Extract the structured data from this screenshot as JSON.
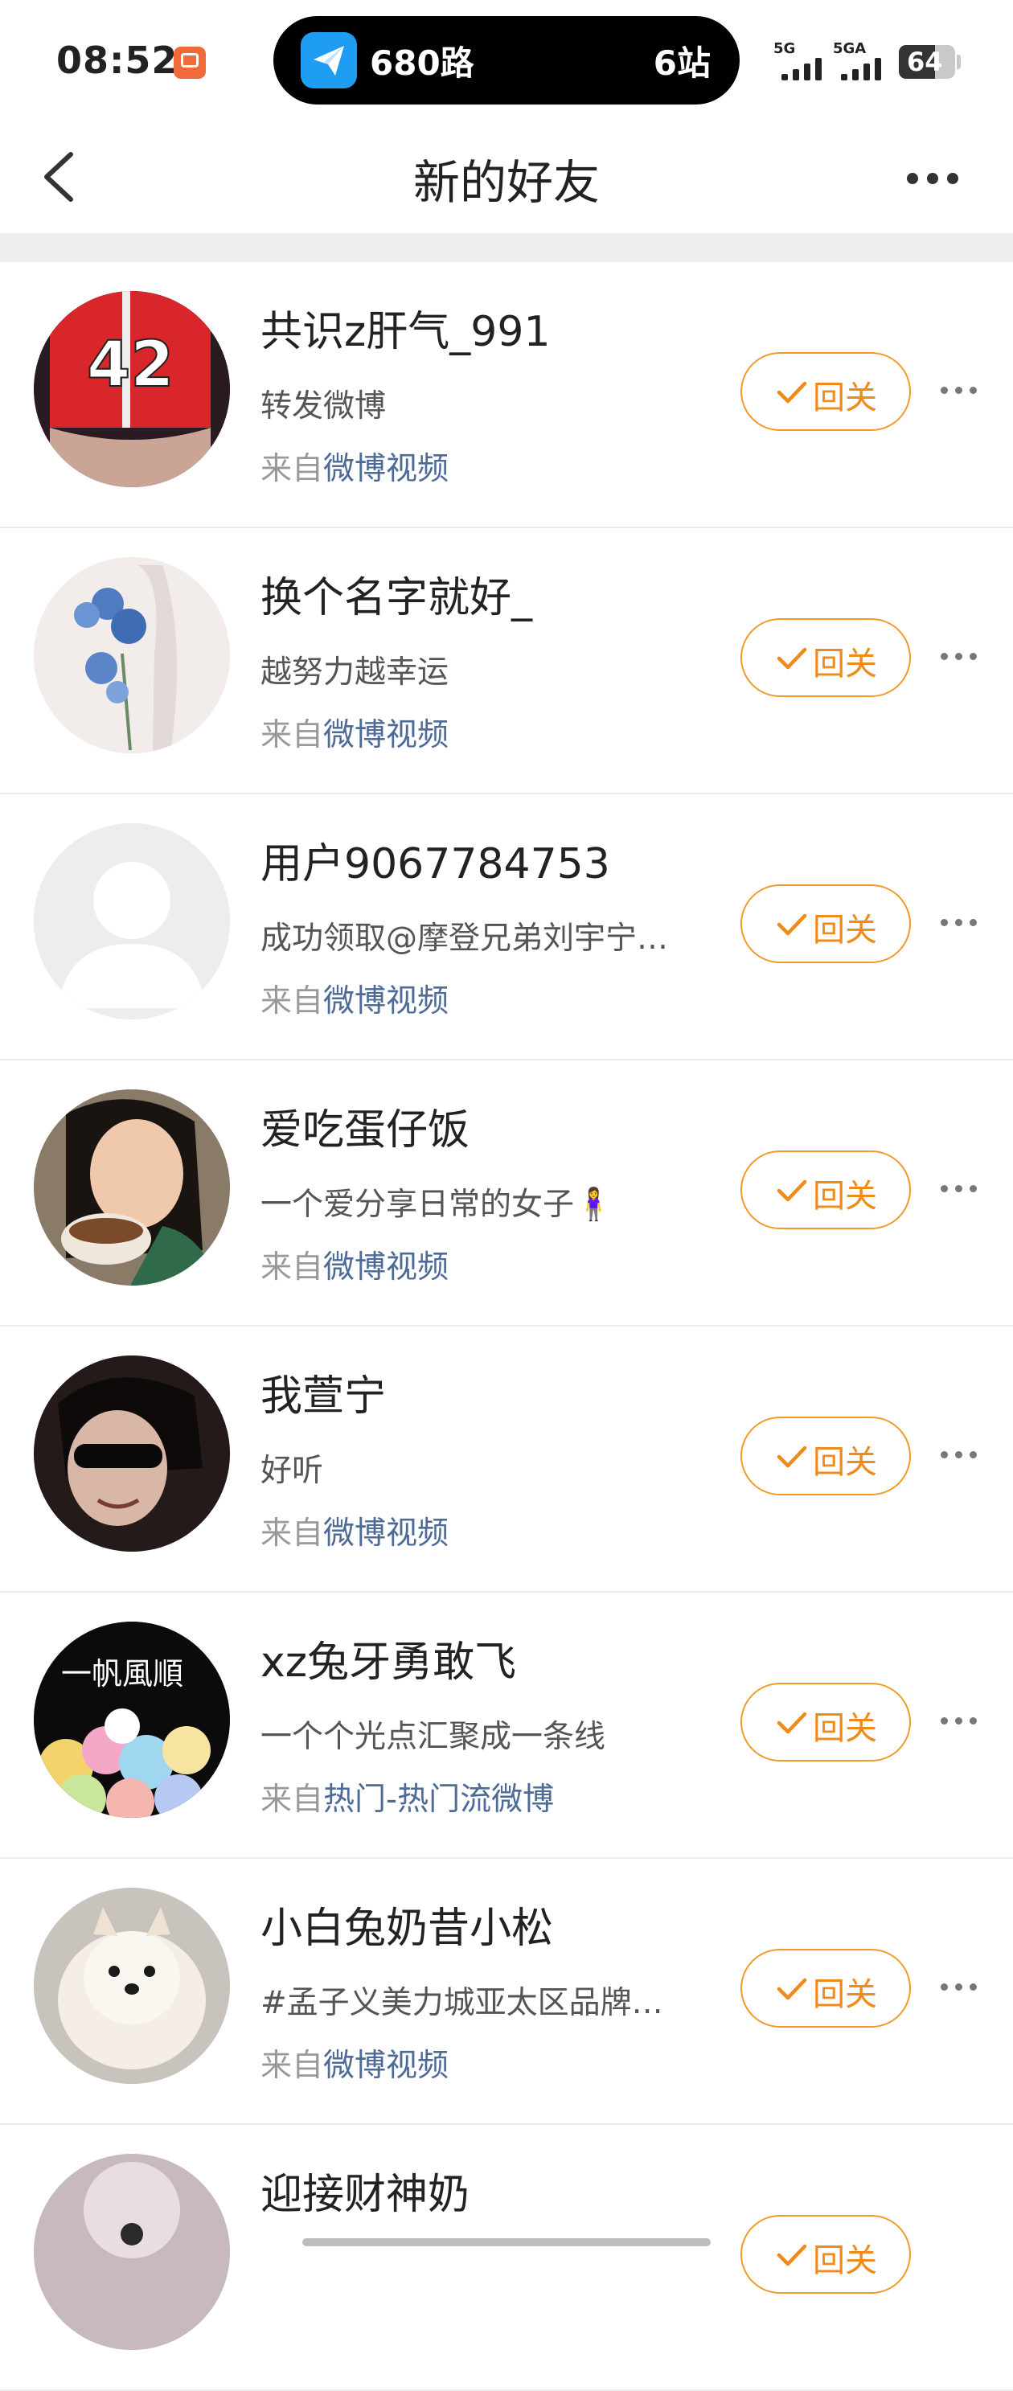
{
  "status_bar": {
    "time": "08:52",
    "live_activity": {
      "route": "680路",
      "stops": "6站"
    },
    "signal_1": "5G",
    "signal_2": "5GA",
    "battery": "64",
    "battery_level": 0.64
  },
  "nav": {
    "title": "新的好友"
  },
  "friends": [
    {
      "name": "共识z肝气_991",
      "bio": "转发微博",
      "source_prefix": "来自",
      "source": "微博视频",
      "button": "回关"
    },
    {
      "name": "换个名字就好_",
      "bio": "越努力越幸运",
      "source_prefix": "来自",
      "source": "微博视频",
      "button": "回关"
    },
    {
      "name": "用户9067784753",
      "bio": "成功领取@摩登兄弟刘宇宁…",
      "source_prefix": "来自",
      "source": "微博视频",
      "button": "回关"
    },
    {
      "name": "爱吃蛋仔饭",
      "bio": "一个爱分享日常的女子🧍‍♀️",
      "source_prefix": "来自",
      "source": "微博视频",
      "button": "回关"
    },
    {
      "name": "我萱宁",
      "bio": "好听",
      "source_prefix": "来自",
      "source": "微博视频",
      "button": "回关"
    },
    {
      "name": "xz兔牙勇敢飞",
      "bio": "一个个光点汇聚成一条线",
      "source_prefix": "来自",
      "source": "热门-热门流微博",
      "button": "回关"
    },
    {
      "name": "小白兔奶昔小松",
      "bio": "#孟子义美力城亚太区品牌…",
      "source_prefix": "来自",
      "source": "微博视频",
      "button": "回关"
    },
    {
      "name": "迎接财神奶",
      "bio": "",
      "source_prefix": "",
      "source": "",
      "button": "回关"
    }
  ],
  "avatar_texts": {
    "jersey_number": "42",
    "banner_text": "一帆風順"
  },
  "colors": {
    "accent": "#f08a1a",
    "link": "#4e6a96",
    "divider": "#efefef"
  }
}
